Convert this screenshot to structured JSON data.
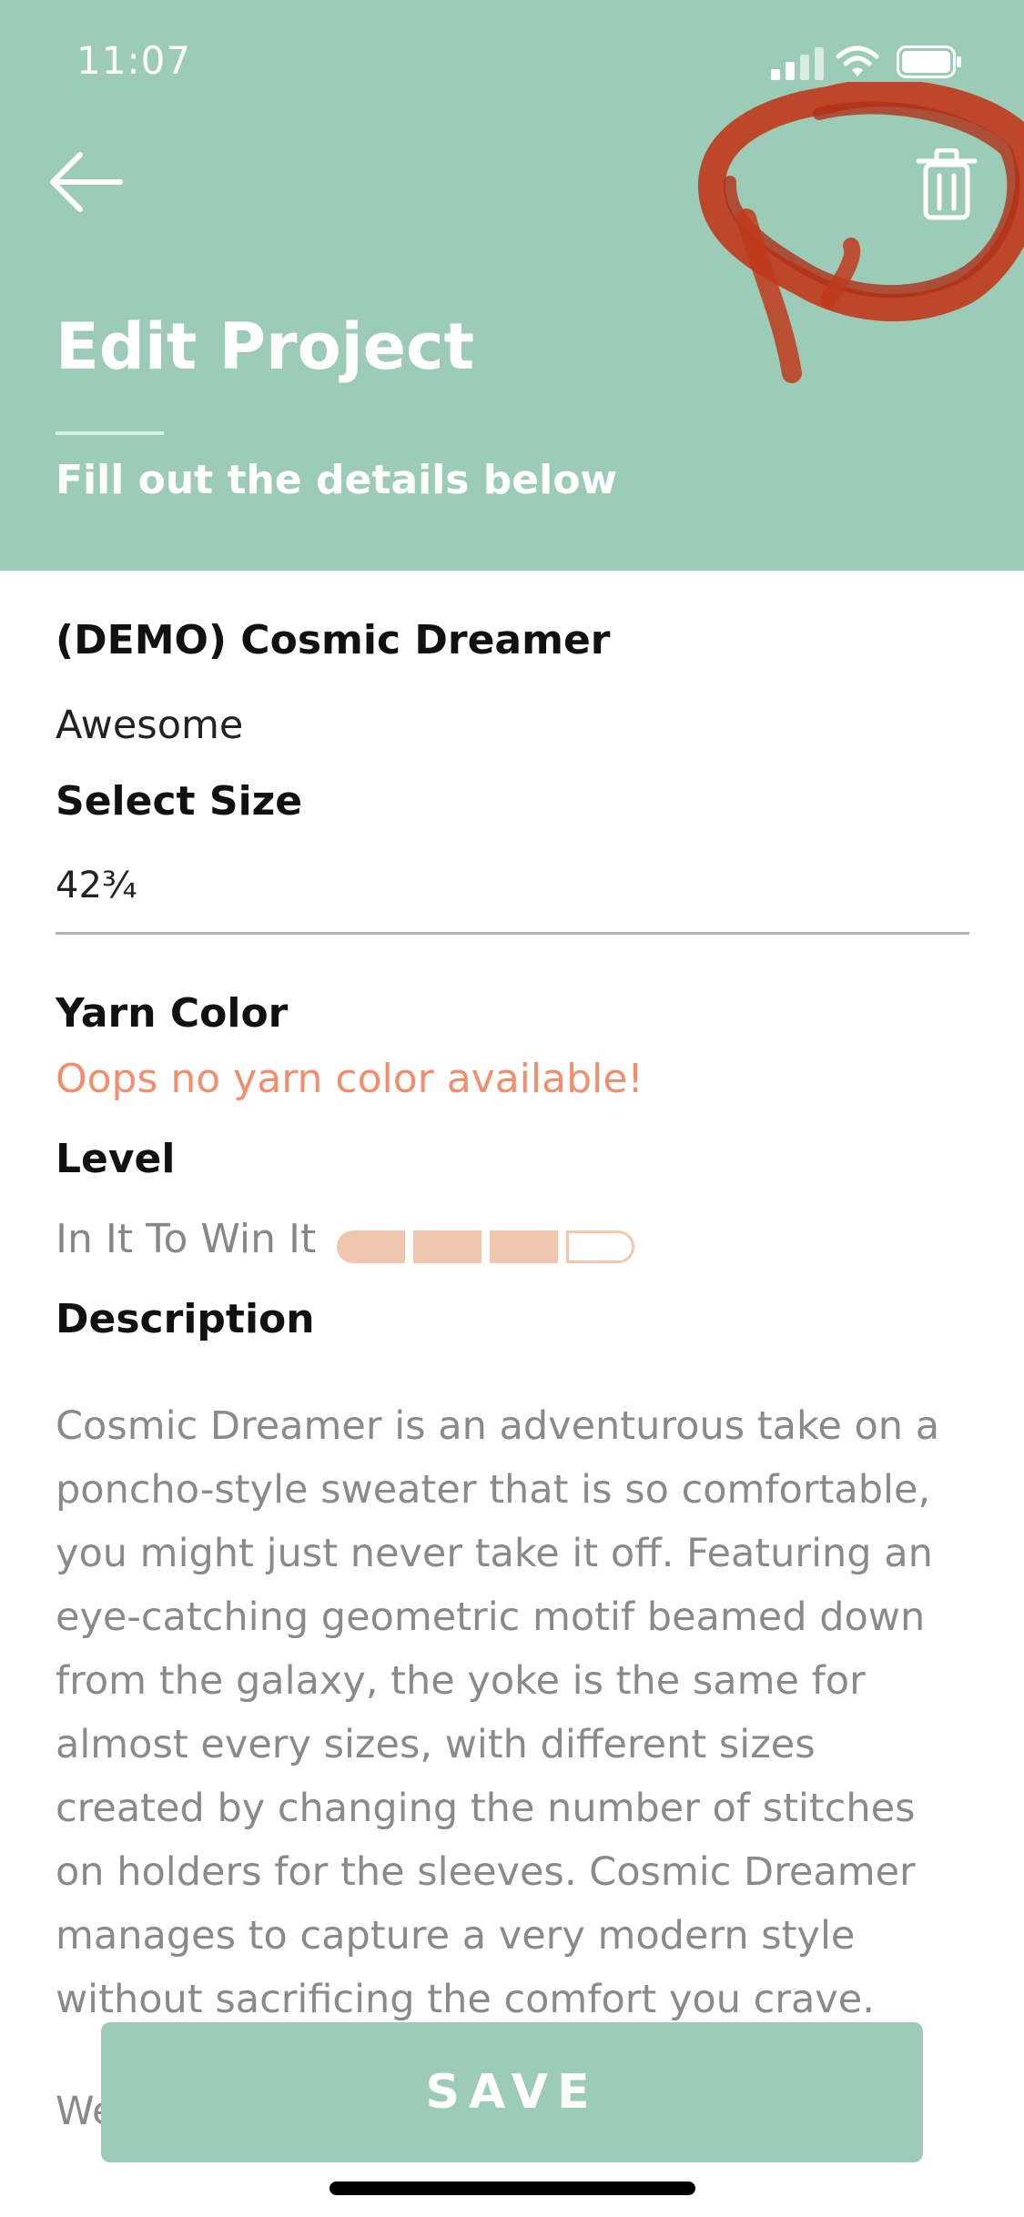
{
  "status_bar": {
    "time": "11:07",
    "icons": [
      "signal-icon",
      "wifi-icon",
      "battery-icon"
    ]
  },
  "header": {
    "title": "Edit Project",
    "subtitle": "Fill out the details below",
    "back_icon": "back-arrow-icon",
    "trash_icon": "trash-icon",
    "background_color": "#9ccbb8"
  },
  "project": {
    "name": "(DEMO) Cosmic Dreamer",
    "tagline": "Awesome"
  },
  "size": {
    "label": "Select Size",
    "value": "42¾"
  },
  "yarn": {
    "label": "Yarn Color",
    "message": "Oops no yarn color available!",
    "message_color": "#f08f6e"
  },
  "level": {
    "label": "Level",
    "value": "In It To Win It",
    "filled_segments": 3,
    "total_segments": 4,
    "meter_color": "#f0c8b0"
  },
  "description": {
    "label": "Description",
    "text": "Cosmic Dreamer is an adventurous take on a poncho-style sweater that is so comfortable, you might just never take it off. Featuring an eye-catching geometric motif beamed down from the galaxy, the yoke is the same for almost every sizes, with different sizes created by changing the number of stitches on holders for the sleeves. Cosmic Dreamer manages to capture a very modern style without sacrificing the comfort you crave.",
    "continuation": "We"
  },
  "save_button": {
    "label": "SAVE"
  }
}
